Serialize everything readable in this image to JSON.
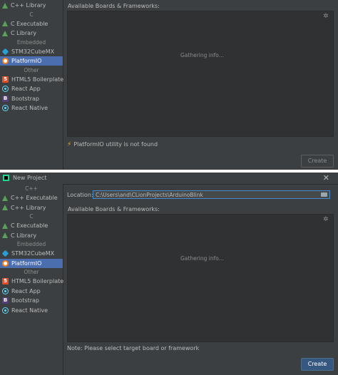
{
  "top_panel": {
    "sidebar": {
      "items": [
        {
          "type": "item",
          "label": "C++ Library",
          "icon": "clion-triangle-icon"
        },
        {
          "type": "header",
          "label": "C"
        },
        {
          "type": "item",
          "label": "C Executable",
          "icon": "clion-triangle-icon"
        },
        {
          "type": "item",
          "label": "C Library",
          "icon": "clion-triangle-icon"
        },
        {
          "type": "header",
          "label": "Embedded"
        },
        {
          "type": "item",
          "label": "STM32CubeMX",
          "icon": "cube-icon"
        },
        {
          "type": "item",
          "label": "PlatformIO",
          "icon": "platformio-icon",
          "selected": true
        },
        {
          "type": "header",
          "label": "Other"
        },
        {
          "type": "item",
          "label": "HTML5 Boilerplate",
          "icon": "html5-icon"
        },
        {
          "type": "item",
          "label": "React App",
          "icon": "react-icon"
        },
        {
          "type": "item",
          "label": "Bootstrap",
          "icon": "bootstrap-icon"
        },
        {
          "type": "item",
          "label": "React Native",
          "icon": "react-icon"
        }
      ]
    },
    "boards_label": "Available Boards & Frameworks:",
    "gathering_text": "Gathering info...",
    "warning_text": "PlatformIO utility is not found",
    "create_label": "Create"
  },
  "bottom_panel": {
    "title": "New Project",
    "close_glyph": "✕",
    "location_label": "Location:",
    "location_value": "C:\\Users\\and\\CLionProjects\\ArduinoBlink",
    "sidebar": {
      "items": [
        {
          "type": "header",
          "label": "C++"
        },
        {
          "type": "item",
          "label": "C++ Executable",
          "icon": "clion-triangle-icon"
        },
        {
          "type": "item",
          "label": "C++ Library",
          "icon": "clion-triangle-icon"
        },
        {
          "type": "header",
          "label": "C"
        },
        {
          "type": "item",
          "label": "C Executable",
          "icon": "clion-triangle-icon"
        },
        {
          "type": "item",
          "label": "C Library",
          "icon": "clion-triangle-icon"
        },
        {
          "type": "header",
          "label": "Embedded"
        },
        {
          "type": "item",
          "label": "STM32CubeMX",
          "icon": "cube-icon"
        },
        {
          "type": "item",
          "label": "PlatformIO",
          "icon": "platformio-icon",
          "selected": true
        },
        {
          "type": "header",
          "label": "Other"
        },
        {
          "type": "item",
          "label": "HTML5 Boilerplate",
          "icon": "html5-icon"
        },
        {
          "type": "item",
          "label": "React App",
          "icon": "react-icon"
        },
        {
          "type": "item",
          "label": "Bootstrap",
          "icon": "bootstrap-icon"
        },
        {
          "type": "item",
          "label": "React Native",
          "icon": "react-icon"
        }
      ]
    },
    "boards_label": "Available Boards & Frameworks:",
    "gathering_text": "Gathering info...",
    "note_text": "Note: Please select target board or framework",
    "create_label": "Create"
  },
  "colors": {
    "background": "#3c3f41",
    "selection": "#4b6eaf",
    "primary_button": "#365880",
    "warning": "#f0a732"
  }
}
